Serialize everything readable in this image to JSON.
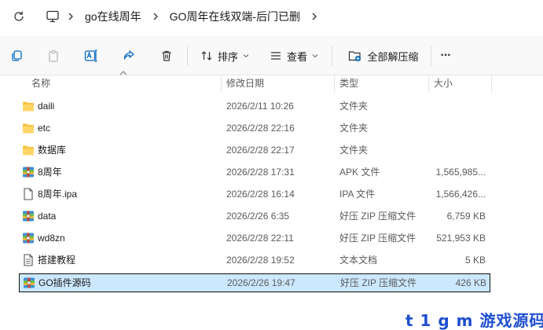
{
  "breadcrumb": {
    "items": [
      "go在线周年",
      "GO周年在线双端-后门已删"
    ]
  },
  "toolbar": {
    "sort_label": "排序",
    "view_label": "查看",
    "extract_label": "全部解压缩",
    "more_label": "···"
  },
  "columns": {
    "name": "名称",
    "date": "修改日期",
    "type": "类型",
    "size": "大小"
  },
  "files": [
    {
      "name": "daili",
      "date": "2026/2/11 10:26",
      "type": "文件夹",
      "size": "",
      "icon": "folder-icon"
    },
    {
      "name": "etc",
      "date": "2026/2/28 22:16",
      "type": "文件夹",
      "size": "",
      "icon": "folder-icon"
    },
    {
      "name": "数据库",
      "date": "2026/2/28 22:17",
      "type": "文件夹",
      "size": "",
      "icon": "folder-icon"
    },
    {
      "name": "8周年",
      "date": "2026/2/28 17:31",
      "type": "APK 文件",
      "size": "1,565,985...",
      "icon": "archive-icon"
    },
    {
      "name": "8周年.ipa",
      "date": "2026/2/28 16:14",
      "type": "IPA 文件",
      "size": "1,566,426...",
      "icon": "file-icon"
    },
    {
      "name": "data",
      "date": "2026/2/26 6:35",
      "type": "好压 ZIP 压缩文件",
      "size": "6,759 KB",
      "icon": "archive-icon"
    },
    {
      "name": "wd8zn",
      "date": "2026/2/28 22:11",
      "type": "好压 ZIP 压缩文件",
      "size": "521,953 KB",
      "icon": "archive-icon"
    },
    {
      "name": "搭建教程",
      "date": "2026/2/28 19:52",
      "type": "文本文档",
      "size": "5 KB",
      "icon": "text-file-icon"
    },
    {
      "name": "GO插件源码",
      "date": "2026/2/26 19:47",
      "type": "好压 ZIP 压缩文件",
      "size": "426 KB",
      "icon": "archive-icon",
      "selected": true
    }
  ],
  "watermark": "t 1 g m 游戏源码网",
  "colors": {
    "folder": "#f5c242",
    "selection": "#cce8ff",
    "accent": "#0067c0",
    "watermark": "#1e4fd0"
  }
}
